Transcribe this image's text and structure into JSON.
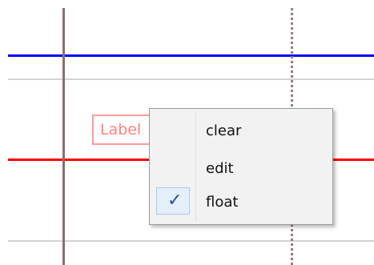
{
  "canvas": {
    "label": "Label"
  },
  "context_menu": {
    "items": [
      {
        "label": "clear",
        "checked": false
      },
      {
        "label": "edit",
        "checked": false
      },
      {
        "label": "float",
        "checked": true
      }
    ],
    "check_glyph": "✓",
    "check_icon": "checkmark-icon"
  },
  "colors": {
    "blue_line": "#0000ff",
    "red_line": "#ff0000",
    "label_border": "#ff9a9a",
    "label_text": "#ff8080",
    "check": "#1f4ea8"
  }
}
